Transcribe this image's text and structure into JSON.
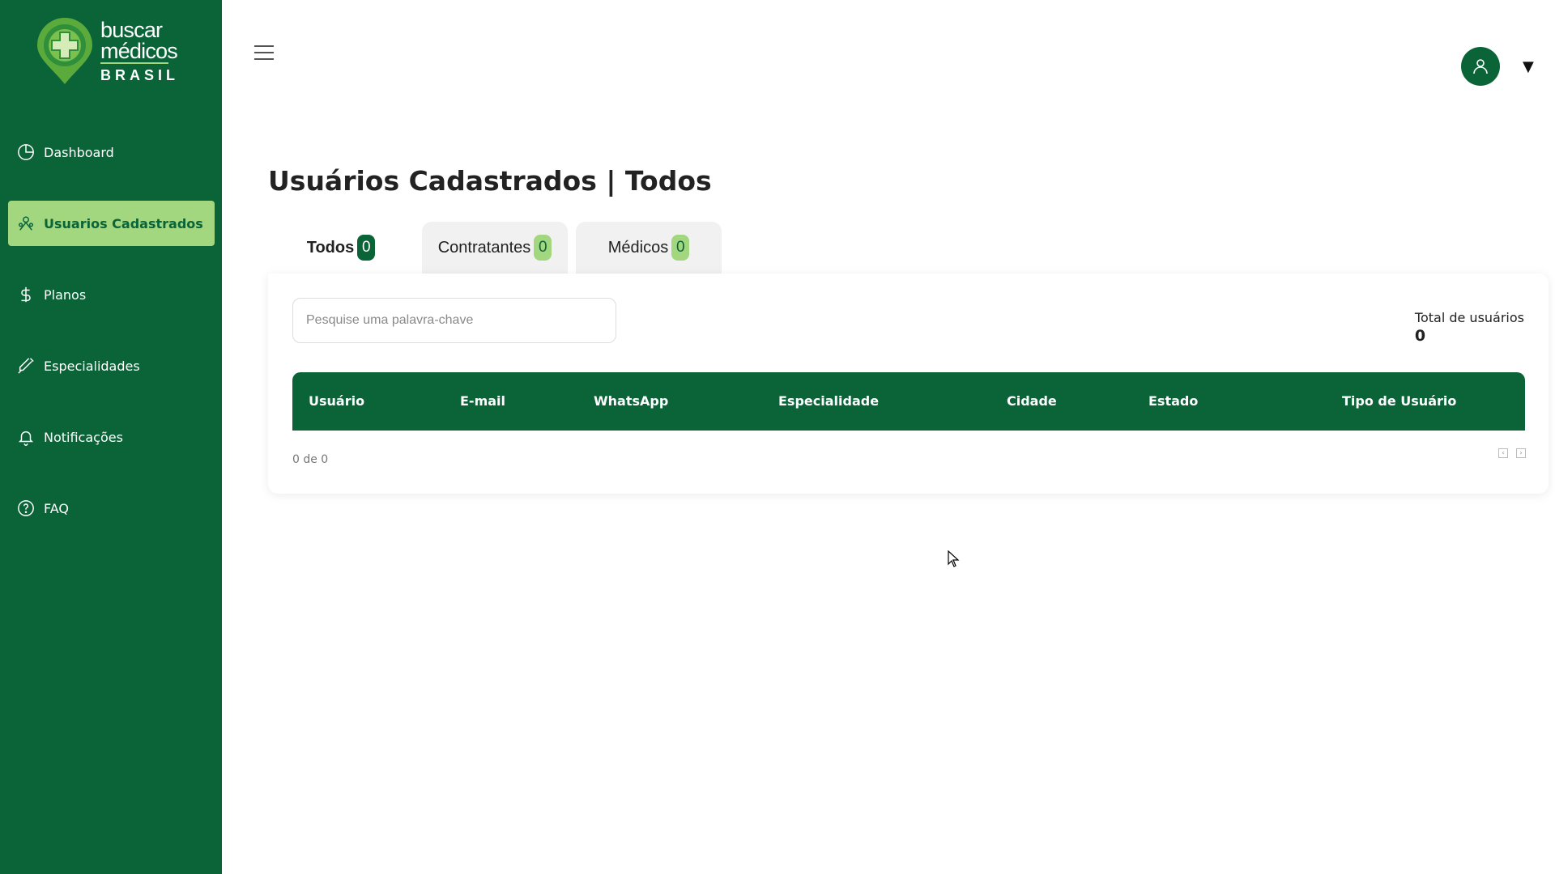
{
  "brand": {
    "line1": "buscar",
    "line2": "médicos",
    "line3": "BRASIL",
    "primary_color": "#0a6438",
    "accent_color": "#a2d67f"
  },
  "sidebar": {
    "items": [
      {
        "label": "Dashboard",
        "icon": "pie-chart-icon",
        "active": false
      },
      {
        "label": "Usuarios Cadastrados",
        "icon": "users-icon",
        "active": true
      },
      {
        "label": "Planos",
        "icon": "dollar-icon",
        "active": false
      },
      {
        "label": "Especialidades",
        "icon": "syringe-icon",
        "active": false
      },
      {
        "label": "Notificações",
        "icon": "bell-icon",
        "active": false
      },
      {
        "label": "FAQ",
        "icon": "help-circle-icon",
        "active": false
      }
    ]
  },
  "header": {
    "menu_icon": "hamburger-icon",
    "avatar_icon": "user-icon",
    "caret": "▼"
  },
  "main": {
    "title": "Usuários Cadastrados | Todos",
    "tabs": [
      {
        "label": "Todos",
        "count": "0",
        "active": true
      },
      {
        "label": "Contratantes",
        "count": "0",
        "active": false
      },
      {
        "label": "Médicos",
        "count": "0",
        "active": false
      }
    ],
    "search": {
      "placeholder": "Pesquise uma palavra-chave",
      "value": ""
    },
    "total": {
      "label": "Total de usuários",
      "value": "0"
    },
    "table": {
      "columns": [
        "Usuário",
        "E-mail",
        "WhatsApp",
        "Especialidade",
        "Cidade",
        "Estado",
        "Tipo de Usuário"
      ],
      "rows": []
    },
    "pagination": {
      "label": "0 de 0"
    }
  }
}
